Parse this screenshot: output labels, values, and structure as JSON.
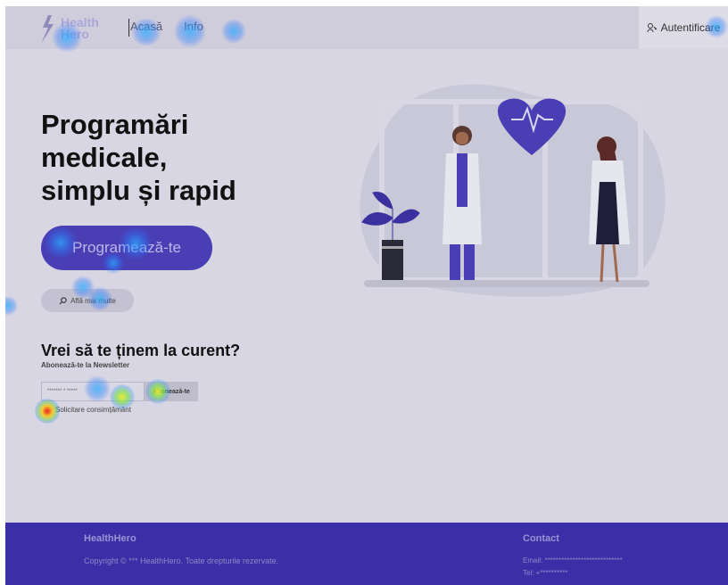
{
  "header": {
    "logo_line1": "Health",
    "logo_line2": "Hero",
    "nav": [
      "Acasă",
      "Info"
    ],
    "login_label": "Autentificare"
  },
  "hero": {
    "title_lines": [
      "Programări",
      "medicale,",
      "simplu și rapid"
    ],
    "cta_label": "Programează-te",
    "more_label": "Află mai multe"
  },
  "newsletter": {
    "title": "Vrei să te ținem la curent?",
    "subtitle": "Abonează-te la Newsletter",
    "input_placeholder": "******* * *****",
    "button_label": "Abonează-te",
    "consent_label": "Solicitare consimțământ"
  },
  "footer": {
    "brand": "HealthHero",
    "copyright": "Copyright © *** HealthHero. Toate drepturile rezervate.",
    "contact_title": "Contact",
    "email": "Email: ****************************",
    "tel": "Tel: +**********"
  },
  "colors": {
    "accent": "#4a3eb4",
    "footer": "#3a2fa6",
    "heart": "#4a3eb4"
  }
}
